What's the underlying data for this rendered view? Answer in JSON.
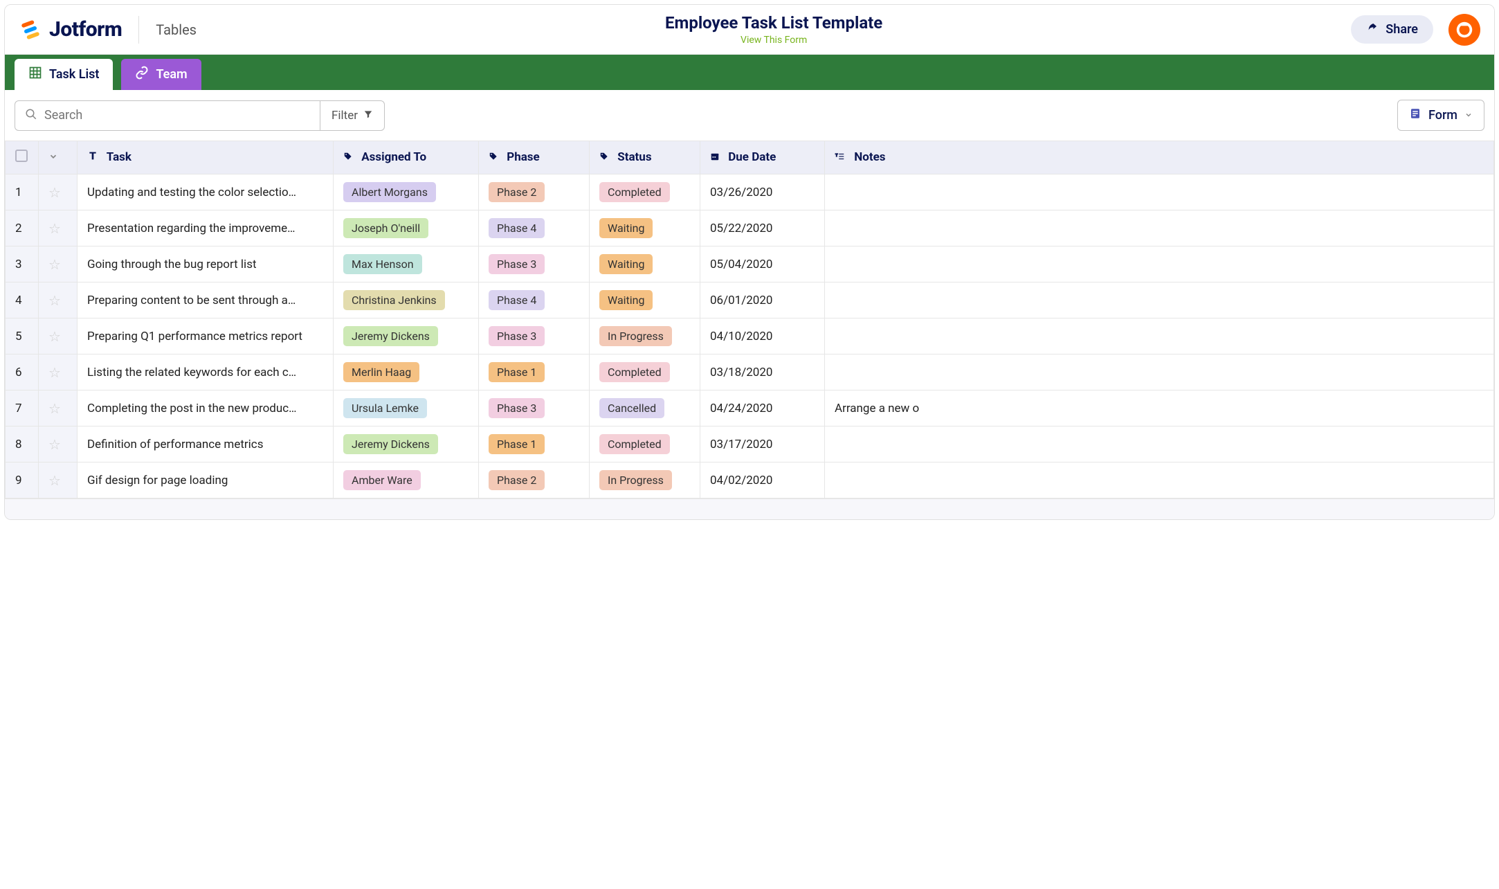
{
  "header": {
    "brand": "Jotform",
    "section": "Tables",
    "title": "Employee Task List Template",
    "subtitle": "View This Form",
    "share": "Share"
  },
  "tabs": [
    {
      "label": "Task List",
      "active": true
    },
    {
      "label": "Team",
      "active": false
    }
  ],
  "toolbar": {
    "search_placeholder": "Search",
    "filter": "Filter",
    "form": "Form"
  },
  "columns": {
    "task": "Task",
    "assigned": "Assigned To",
    "phase": "Phase",
    "status": "Status",
    "due": "Due Date",
    "notes": "Notes"
  },
  "rows": [
    {
      "idx": "1",
      "task": "Updating and testing the color selectio…",
      "assigned": "Albert Morgans",
      "assigned_c": "c-purple",
      "phase": "Phase 2",
      "phase_c": "c-peach",
      "status": "Completed",
      "status_c": "c-rose",
      "due": "03/26/2020",
      "notes": ""
    },
    {
      "idx": "2",
      "task": "Presentation regarding the improveme…",
      "assigned": "Joseph O'neill",
      "assigned_c": "c-lgreen",
      "phase": "Phase 4",
      "phase_c": "c-lpurple",
      "status": "Waiting",
      "status_c": "c-orange",
      "due": "05/22/2020",
      "notes": ""
    },
    {
      "idx": "3",
      "task": "Going through the bug report list",
      "assigned": "Max Henson",
      "assigned_c": "c-teal",
      "phase": "Phase 3",
      "phase_c": "c-pink",
      "status": "Waiting",
      "status_c": "c-orange",
      "due": "05/04/2020",
      "notes": ""
    },
    {
      "idx": "4",
      "task": "Preparing content to be sent through a…",
      "assigned": "Christina Jenkins",
      "assigned_c": "c-tan",
      "phase": "Phase 4",
      "phase_c": "c-lpurple",
      "status": "Waiting",
      "status_c": "c-orange",
      "due": "06/01/2020",
      "notes": ""
    },
    {
      "idx": "5",
      "task": "Preparing Q1 performance metrics report",
      "assigned": "Jeremy Dickens",
      "assigned_c": "c-lgreen",
      "phase": "Phase 3",
      "phase_c": "c-pink",
      "status": "In Progress",
      "status_c": "c-peach",
      "due": "04/10/2020",
      "notes": ""
    },
    {
      "idx": "6",
      "task": "Listing the related keywords for each c…",
      "assigned": "Merlin Haag",
      "assigned_c": "c-orange",
      "phase": "Phase 1",
      "phase_c": "c-orange",
      "status": "Completed",
      "status_c": "c-rose",
      "due": "03/18/2020",
      "notes": ""
    },
    {
      "idx": "7",
      "task": "Completing the post in the new produc…",
      "assigned": "Ursula Lemke",
      "assigned_c": "c-lblue",
      "phase": "Phase 3",
      "phase_c": "c-pink",
      "status": "Cancelled",
      "status_c": "c-lpurple",
      "due": "04/24/2020",
      "notes": "Arrange a new o"
    },
    {
      "idx": "8",
      "task": "Definition of performance metrics",
      "assigned": "Jeremy Dickens",
      "assigned_c": "c-lgreen",
      "phase": "Phase 1",
      "phase_c": "c-orange",
      "status": "Completed",
      "status_c": "c-rose",
      "due": "03/17/2020",
      "notes": ""
    },
    {
      "idx": "9",
      "task": "Gif design for page loading",
      "assigned": "Amber Ware",
      "assigned_c": "c-pink",
      "phase": "Phase 2",
      "phase_c": "c-peach",
      "status": "In Progress",
      "status_c": "c-peach",
      "due": "04/02/2020",
      "notes": ""
    }
  ]
}
